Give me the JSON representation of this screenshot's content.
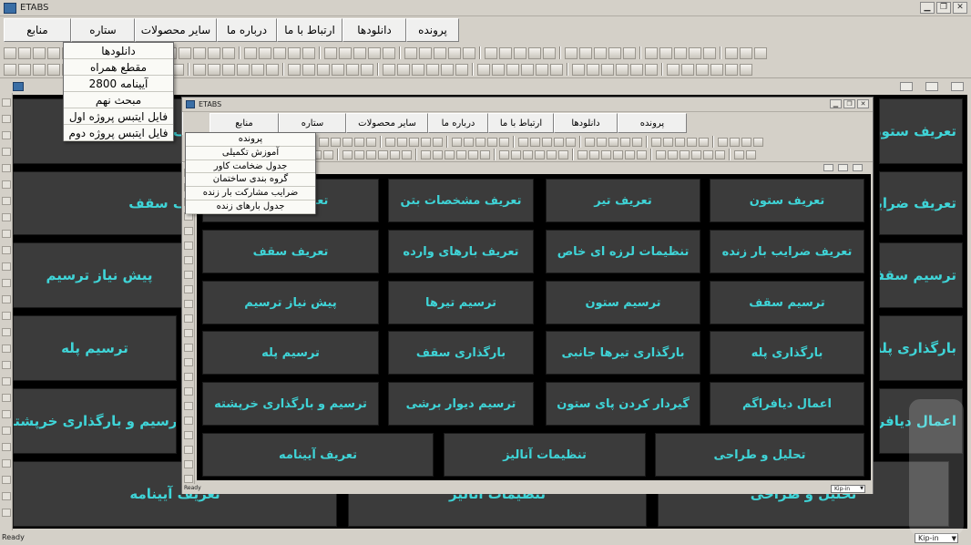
{
  "app": {
    "title": "ETABS",
    "window_buttons": [
      "▁",
      "❐",
      "✕"
    ]
  },
  "menu": [
    "پرونده",
    "دانلودها",
    "ارتباط با ما",
    "درباره ما",
    "سایر محصولات",
    "ستاره",
    "منابع"
  ],
  "downloads_menu": [
    "دانلودها",
    "مقطع همراه",
    "آیینامه 2800",
    "مبحث نهم",
    "فایل ایتبس پروژه اول",
    "فایل ایتبس پروژه دوم"
  ],
  "file_menu": [
    "پرونده",
    "آموزش تکمیلی",
    "جدول ضخامت کاور",
    "گروه بندی ساختمان",
    "ضرایب مشارکت بار زنده",
    "جدول بارهای زنده"
  ],
  "tiles": [
    [
      "تعریف ستون",
      "تعریف تیر",
      "تعریف مشخصات بتن",
      "تعریف سقف"
    ],
    [
      "تعریف ضرایب بار زنده",
      "تنظیمات لرزه ای خاص",
      "تعریف بارهای وارده",
      "تعریف سقف"
    ],
    [
      "ترسیم سقف",
      "ترسیم ستون",
      "ترسیم تیرها",
      "پیش نیاز ترسیم"
    ],
    [
      "بارگذاری پله",
      "بارگذاری تیرها جانبی",
      "بارگذاری سقف",
      "ترسیم پله"
    ],
    [
      "اعمال دیافراگم",
      "گیردار کردن پای ستون",
      "ترسیم دیوار برشی",
      "ترسیم و بارگذاری خرپشته"
    ],
    [
      "تحلیل و طراحی",
      "تنظیمات آنالیز",
      "تعریف آیینامه"
    ]
  ],
  "status": {
    "text": "Ready",
    "units": "Kip-in"
  }
}
